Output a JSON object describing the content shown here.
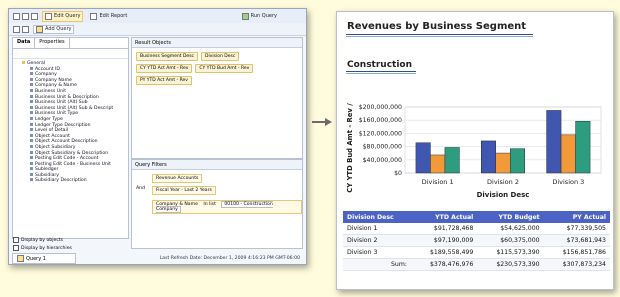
{
  "toolbar": {
    "edit_query": "Edit Query",
    "edit_report": "Edit Report",
    "run_query": "Run Query"
  },
  "toolbar2": {
    "add_query": "Add Query"
  },
  "left": {
    "tabs": [
      "Data",
      "Properties"
    ],
    "tree": [
      "General",
      "Account ID",
      "Company",
      "Company Name",
      "Company & Name",
      "Business Unit",
      "Business Unit & Description",
      "Business Unit (Alt) Sub",
      "Business Unit (Alt) Sub & Descript",
      "Business Unit Type",
      "Ledger Type",
      "Ledger Type Description",
      "Level of Detail",
      "Object Account",
      "Object Account Description",
      "Object Subsidiary",
      "Object Subsidiary & Description",
      "Posting Edit Code - Account",
      "Posting Edit Code - Business Unit",
      "Subledger",
      "Subsidiary",
      "Subsidiary Description"
    ],
    "display_objects": "Display by objects",
    "display_hierarchies": "Display by hierarchies",
    "query_tab": "Query 1"
  },
  "result_objects": {
    "title": "Result Objects",
    "chips": [
      "Business Segment Desc",
      "Division Desc",
      "CY YTD Act Amt - Rev",
      "CY YTD Bud Amt - Rev",
      "PY YTD Act Amt - Rev"
    ]
  },
  "query_filters": {
    "title": "Query Filters",
    "and_label": "And",
    "filters": [
      "Revenue Accounts",
      "Fiscal Year - Last 2 Years",
      "Company & Name"
    ],
    "operator": "In list",
    "value": "00100 - Construction Company"
  },
  "status": {
    "text": "Last Refresh Date: December 1, 2009 4:16:23 PM GMT-06:00"
  },
  "report": {
    "title": "Revenues by Business Segment",
    "subtitle": "Construction",
    "table": {
      "headers": [
        "Division Desc",
        "YTD Actual",
        "YTD Budget",
        "PY Actual"
      ],
      "rows": [
        [
          "Division 1",
          "$91,728,468",
          "$54,625,000",
          "$77,339,505"
        ],
        [
          "Division 2",
          "$97,190,009",
          "$60,375,000",
          "$73,681,943"
        ],
        [
          "Division 3",
          "$189,558,499",
          "$115,573,390",
          "$156,851,786"
        ]
      ],
      "sum": [
        "Sum:",
        "$378,476,976",
        "$230,573,390",
        "$307,873,234"
      ]
    }
  },
  "chart_data": {
    "type": "bar",
    "categories": [
      "Division 1",
      "Division 2",
      "Division 3"
    ],
    "series": [
      {
        "name": "YTD Actual",
        "values": [
          91728468,
          97190009,
          189558499
        ]
      },
      {
        "name": "YTD Budget",
        "values": [
          54625000,
          60375000,
          115573390
        ]
      },
      {
        "name": "PY Actual",
        "values": [
          77339505,
          73681943,
          156851786
        ]
      }
    ],
    "xlabel": "Division Desc",
    "ylabel": "CY YTD Bud Amt - Rev /",
    "yticks": [
      "$0",
      "$40,000,000",
      "$80,000,000",
      "$120,000,000",
      "$160,000,000",
      "$200,000,000"
    ],
    "ylim": [
      0,
      200000000
    ],
    "colors": [
      "#3f57b0",
      "#f29a3a",
      "#2e9c7e"
    ]
  }
}
